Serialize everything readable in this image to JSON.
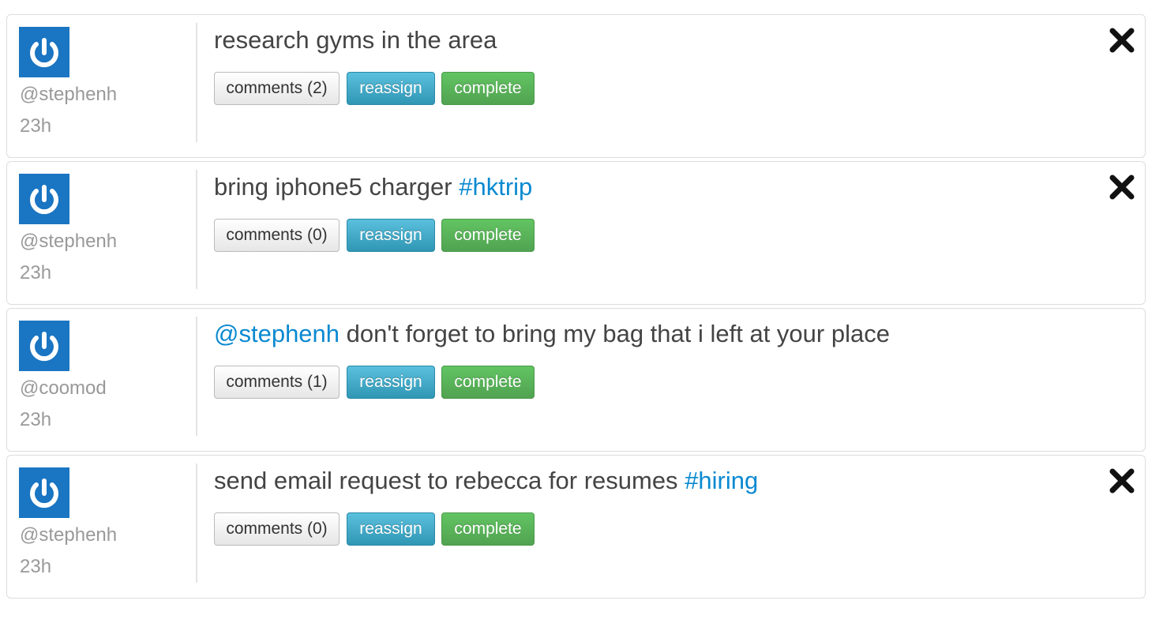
{
  "colors": {
    "avatar_bg": "#1a75c2",
    "link": "#0a89d1",
    "reassign": "#3aa8cc",
    "complete": "#5cb85c"
  },
  "tasks": [
    {
      "username": "@stephenh",
      "time": "23h",
      "mention": "",
      "text": "research gyms in the area",
      "hashtag": "",
      "comments_label": "comments (2)",
      "reassign_label": "reassign",
      "complete_label": "complete",
      "avatar_icon": "power-icon",
      "close_icon": "close-icon"
    },
    {
      "username": "@stephenh",
      "time": "23h",
      "mention": "",
      "text": "bring iphone5 charger ",
      "hashtag": "#hktrip",
      "comments_label": "comments (0)",
      "reassign_label": "reassign",
      "complete_label": "complete",
      "avatar_icon": "power-icon",
      "close_icon": "close-icon"
    },
    {
      "username": "@coomod",
      "time": "23h",
      "mention": "@stephenh",
      "text": " don't forget to bring my bag that i left at your place",
      "hashtag": "",
      "comments_label": "comments (1)",
      "reassign_label": "reassign",
      "complete_label": "complete",
      "avatar_icon": "power-icon",
      "close_icon": ""
    },
    {
      "username": "@stephenh",
      "time": "23h",
      "mention": "",
      "text": "send email request to rebecca for resumes ",
      "hashtag": "#hiring",
      "comments_label": "comments (0)",
      "reassign_label": "reassign",
      "complete_label": "complete",
      "avatar_icon": "power-icon",
      "close_icon": "close-icon"
    }
  ]
}
